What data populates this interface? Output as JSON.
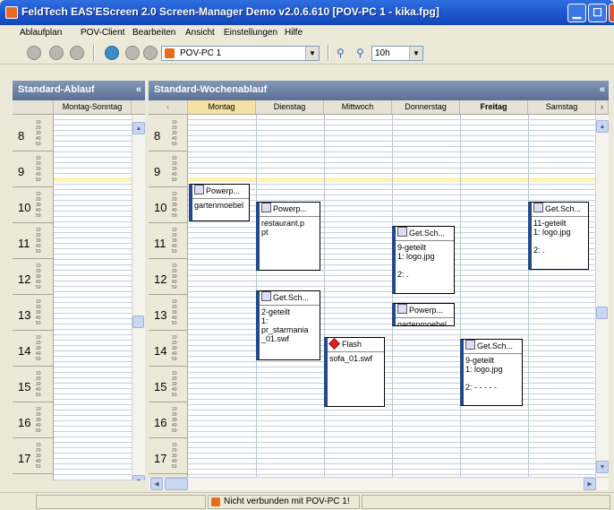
{
  "window": {
    "title": "FeldTech EAS'EScreen 2.0 Screen-Manager Demo v2.0.6.610 [POV-PC 1 - kika.fpg]"
  },
  "menu": [
    "Ablaufplan",
    "POV-Client",
    "Bearbeiten",
    "Ansicht",
    "Einstellungen",
    "Hilfe"
  ],
  "toolbar": {
    "client_select": "POV-PC 1",
    "zoom_select": "10h"
  },
  "left_panel": {
    "title": "Standard-Ablauf",
    "collapse": "«",
    "column": "Montag-Sonntag"
  },
  "main_panel": {
    "title": "Standard-Wochenablauf",
    "collapse": "«",
    "days": [
      "Montag",
      "Dienstag",
      "Mittwoch",
      "Donnerstag",
      "Freitag",
      "Samstag"
    ],
    "nav_prev": "‹",
    "nav_next": "›"
  },
  "hours": [
    "8",
    "9",
    "10",
    "11",
    "12",
    "13",
    "14",
    "15",
    "16",
    "17"
  ],
  "minute_marks": [
    "10",
    "20",
    "30",
    "40",
    "50"
  ],
  "events": [
    {
      "title": "Powerp...",
      "body": "gartenmoebel",
      "type": "powerpoint"
    },
    {
      "title": "Powerp...",
      "body": "restaurant.p\npt",
      "type": "powerpoint"
    },
    {
      "title": "Get.Sch...",
      "body": "2-geteilt\n1:\npr_starmania\n_01.swf",
      "type": "schedule"
    },
    {
      "title": "Flash",
      "body": "sofa_01.swf",
      "type": "flash"
    },
    {
      "title": "Get.Sch...",
      "body": "9-geteilt\n1: logo.jpg\n\n2: .",
      "type": "schedule"
    },
    {
      "title": "Powerp...",
      "body": "gartenmoebel",
      "type": "powerpoint"
    },
    {
      "title": "Get.Sch...",
      "body": "9-geteilt\n1: logo.jpg\n\n2: - - - - -",
      "type": "schedule"
    },
    {
      "title": "Get.Sch...",
      "body": "11-geteilt\n1: logo.jpg\n\n2: .",
      "type": "schedule"
    }
  ],
  "status": {
    "message": "Nicht verbunden mit POV-PC 1!"
  },
  "colors": {
    "titlebar": "#1B53C9",
    "panel_header": "#6F83A8",
    "highlight_row": "#FFF3B0",
    "selected_day": "#F5E1A3",
    "event_border": "#224A8A"
  }
}
